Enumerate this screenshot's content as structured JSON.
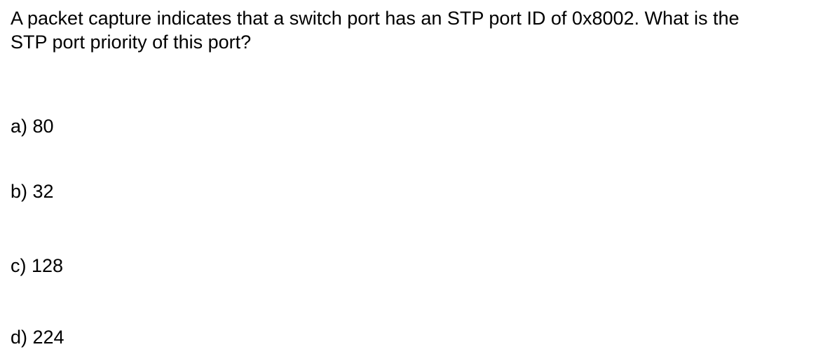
{
  "question": {
    "line1": "A packet capture indicates that a switch port has an STP port ID of 0x8002.  What is the",
    "line2": "STP port priority of this port?"
  },
  "options": [
    {
      "label": "a) 80"
    },
    {
      "label": "b) 32"
    },
    {
      "label": "c) 128"
    },
    {
      "label": "d) 224"
    }
  ]
}
